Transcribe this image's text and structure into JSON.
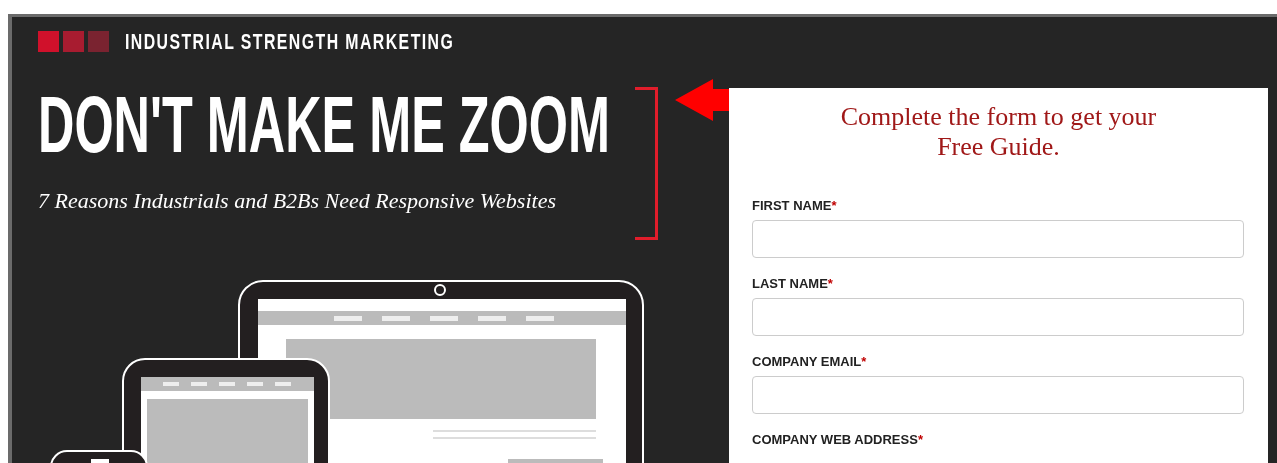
{
  "brand": {
    "name": "INDUSTRIAL STRENGTH MARKETING"
  },
  "hero": {
    "title": "DON'T MAKE ME ZOOM",
    "subtitle": "7 Reasons Industrials and B2Bs Need Responsive Websites"
  },
  "form": {
    "title": "Complete the form to get your Free Guide.",
    "fields": [
      {
        "label": "FIRST NAME",
        "required_mark": "*"
      },
      {
        "label": "LAST NAME",
        "required_mark": "*"
      },
      {
        "label": "COMPANY EMAIL",
        "required_mark": "*"
      },
      {
        "label": "COMPANY WEB ADDRESS",
        "required_mark": "*"
      }
    ]
  }
}
